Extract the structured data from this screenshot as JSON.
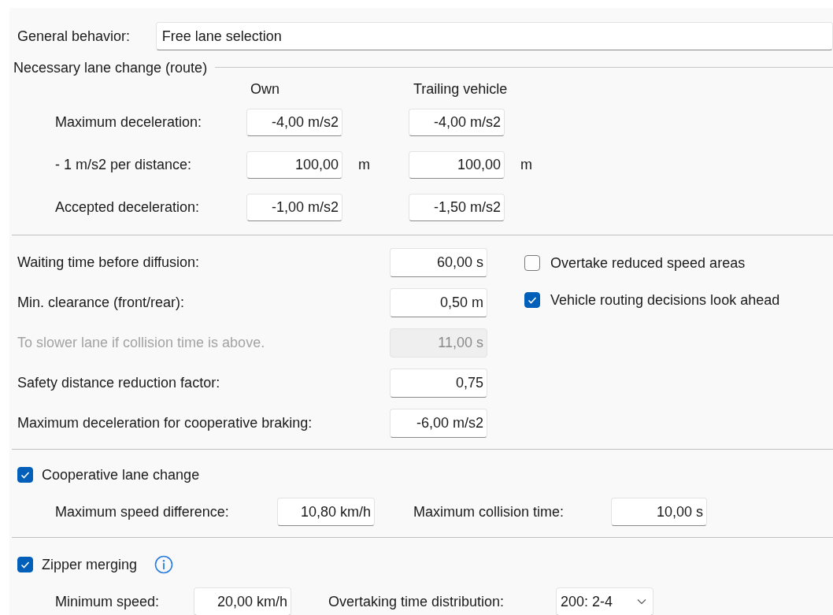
{
  "general_behavior": {
    "label": "General behavior:",
    "value": "Free lane selection"
  },
  "necessary_lane_change": {
    "title": "Necessary lane change (route)",
    "columns": [
      "Own",
      "Trailing vehicle"
    ],
    "rows": [
      {
        "label": "Maximum deceleration:",
        "values": [
          "-4,00 m/s2",
          "-4,00 m/s2"
        ]
      },
      {
        "label": "- 1 m/s2 per distance:",
        "values": [
          "100,00",
          "100,00"
        ],
        "units": [
          "m",
          "m"
        ]
      },
      {
        "label": "Accepted deceleration:",
        "values": [
          "-1,00 m/s2",
          "-1,50 m/s2"
        ]
      }
    ]
  },
  "parameters": [
    {
      "label": "Waiting time before diffusion:",
      "value": "60,00 s",
      "disabled": false
    },
    {
      "label": "Min. clearance (front/rear):",
      "value": "0,50 m",
      "disabled": false
    },
    {
      "label": "To slower lane if collision time is above.",
      "value": "11,00 s",
      "disabled": true
    },
    {
      "label": "Safety distance reduction factor:",
      "value": "0,75",
      "disabled": false
    },
    {
      "label": "Maximum deceleration for cooperative braking:",
      "value": "-6,00 m/s2",
      "disabled": false
    }
  ],
  "options": [
    {
      "label": "Overtake reduced speed areas",
      "checked": false
    },
    {
      "label": "Vehicle routing decisions look ahead",
      "checked": true
    }
  ],
  "cooperative_lane_change": {
    "label": "Cooperative lane change",
    "checked": true,
    "fields": [
      {
        "label": "Maximum speed difference:",
        "value": "10,80 km/h",
        "kind": "field"
      },
      {
        "label": "Maximum collision time:",
        "value": "10,00 s",
        "kind": "field"
      }
    ]
  },
  "zipper_merging": {
    "label": "Zipper merging",
    "checked": true,
    "info": true,
    "fields": [
      {
        "label": "Minimum speed:",
        "value": "20,00 km/h",
        "kind": "field"
      },
      {
        "label": "Overtaking time distribution:",
        "value": "200: 2-4",
        "kind": "dropdown"
      }
    ]
  }
}
